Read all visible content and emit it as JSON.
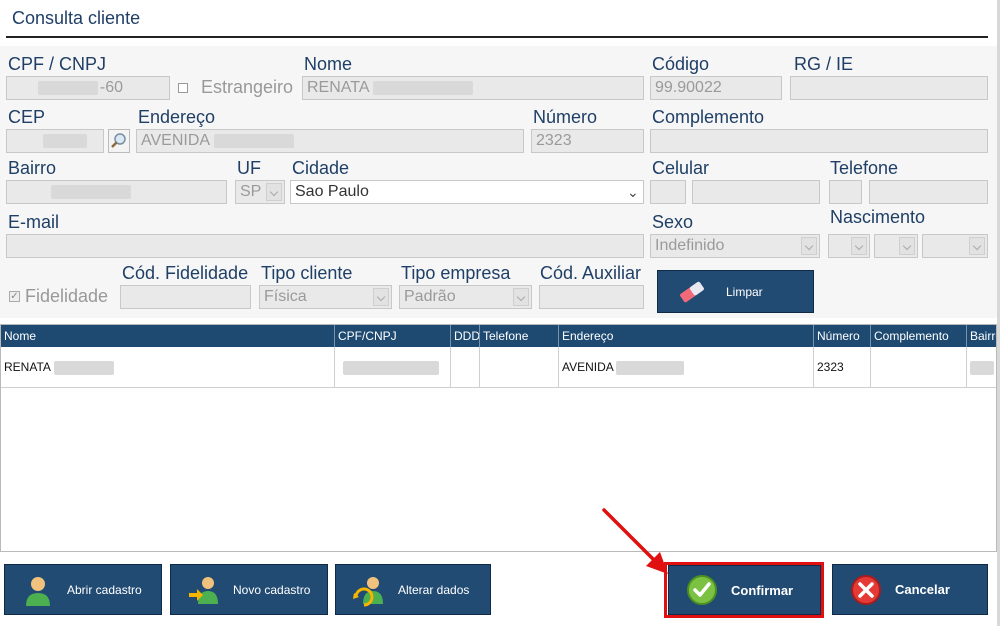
{
  "window": {
    "title": "Consulta cliente"
  },
  "form": {
    "cpf_label": "CPF / CNPJ",
    "cpf_value": "-60",
    "estrangeiro_label": "Estrangeiro",
    "nome_label": "Nome",
    "nome_value": "RENATA",
    "codigo_label": "Código",
    "codigo_value": "99.90022",
    "rg_label": "RG / IE",
    "cep_label": "CEP",
    "endereco_label": "Endereço",
    "endereco_value": "AVENIDA",
    "numero_label": "Número",
    "numero_value": "2323",
    "complemento_label": "Complemento",
    "bairro_label": "Bairro",
    "uf_label": "UF",
    "uf_value": "SP",
    "cidade_label": "Cidade",
    "cidade_value": "Sao Paulo",
    "celular_label": "Celular",
    "telefone_label": "Telefone",
    "email_label": "E-mail",
    "sexo_label": "Sexo",
    "sexo_value": "Indefinido",
    "nascimento_label": "Nascimento",
    "fidelidade_label": "Fidelidade",
    "cod_fidelidade_label": "Cód. Fidelidade",
    "tipo_cliente_label": "Tipo cliente",
    "tipo_cliente_value": "Física",
    "tipo_empresa_label": "Tipo empresa",
    "tipo_empresa_value": "Padrão",
    "cod_auxiliar_label": "Cód. Auxiliar",
    "limpar_label": "Limpar"
  },
  "grid": {
    "columns": [
      "Nome",
      "CPF/CNPJ",
      "DDD",
      "Telefone",
      "Endereço",
      "Número",
      "Complemento",
      "Bairro"
    ],
    "rows": [
      {
        "nome": "RENATA",
        "endereco": "AVENIDA",
        "numero": "2323"
      }
    ]
  },
  "buttons": {
    "abrir": "Abrir cadastro",
    "novo": "Novo cadastro",
    "alterar": "Alterar dados",
    "confirmar": "Confirmar",
    "cancelar": "Cancelar"
  },
  "colors": {
    "button_bg": "#224b73",
    "header_bg": "#1e4a72",
    "highlight": "#e01010",
    "label": "#1f3f66"
  }
}
